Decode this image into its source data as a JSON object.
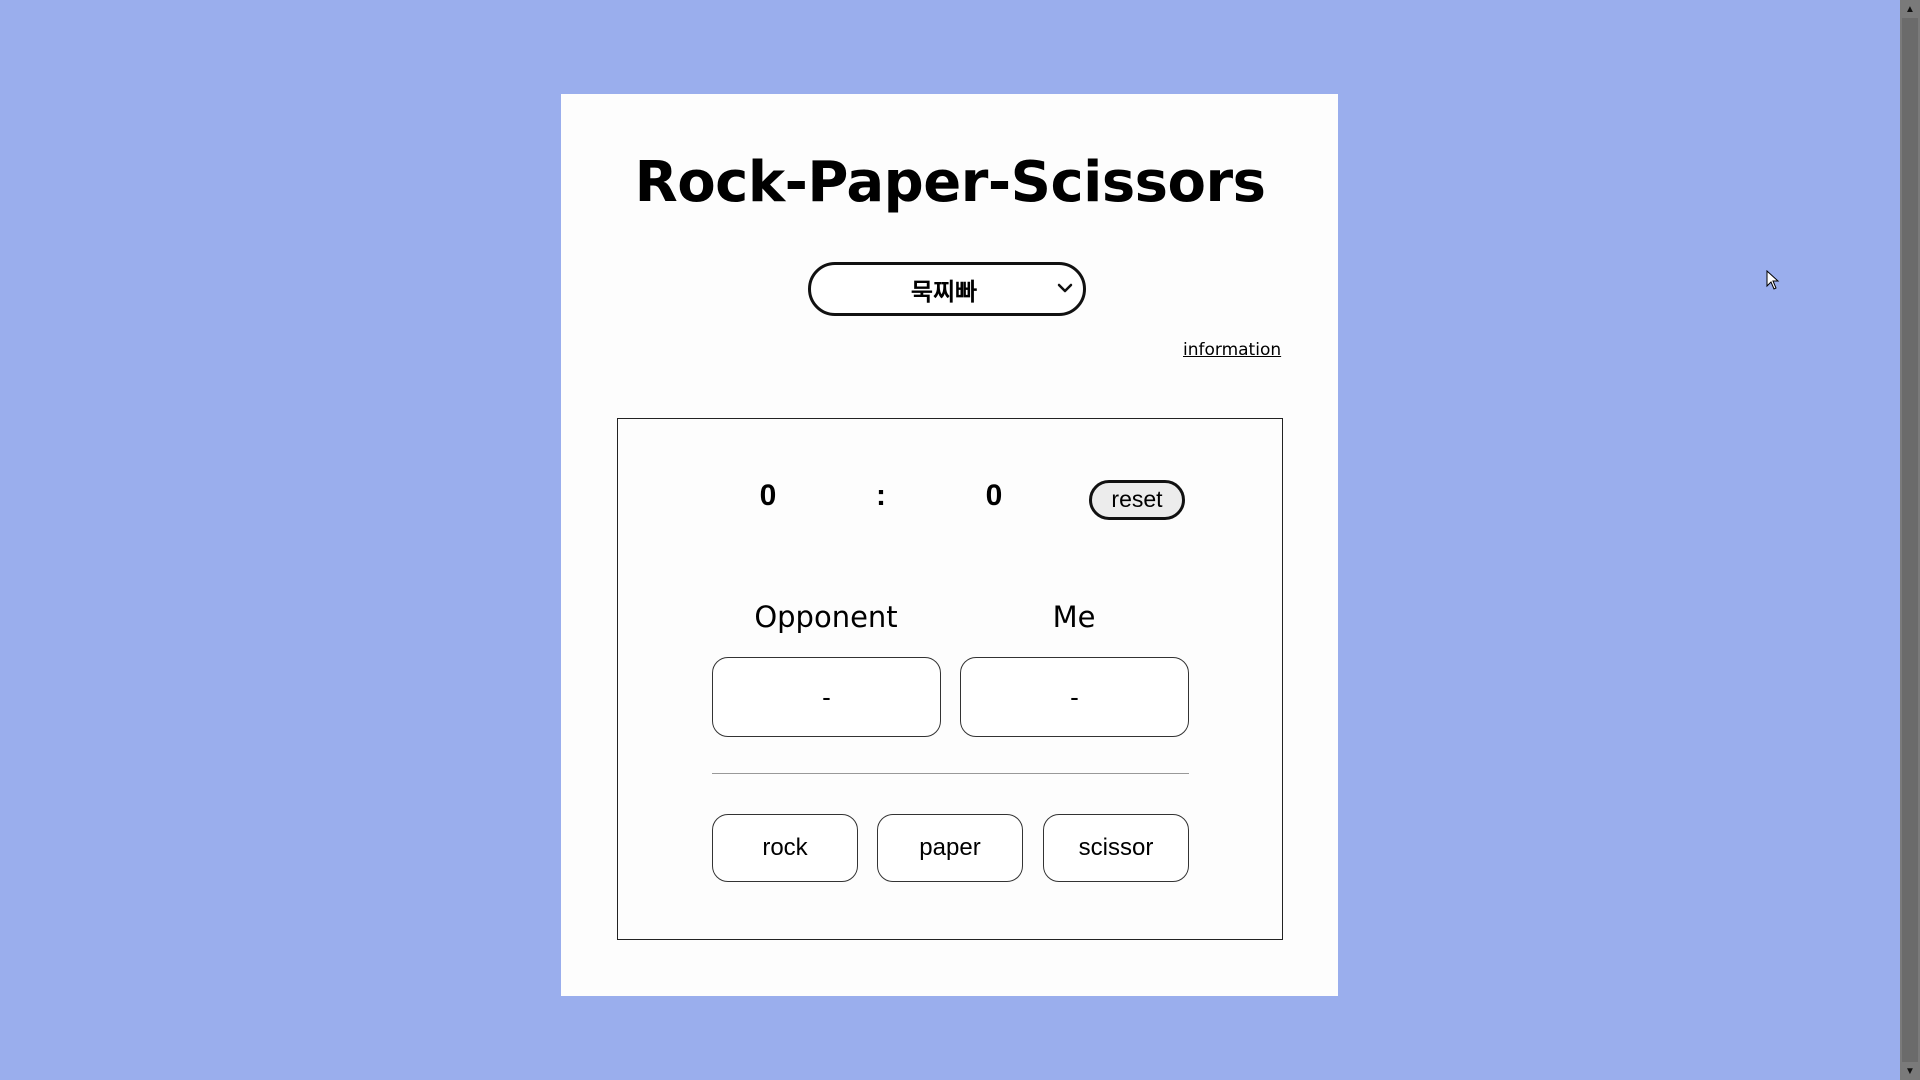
{
  "app": {
    "title": "Rock-Paper-Scissors",
    "background_color": "#9aaeed"
  },
  "mode_select": {
    "selected": "묵찌빠",
    "icon": "chevron-down-icon"
  },
  "info_link": {
    "label": "information"
  },
  "scoreboard": {
    "opponent_score": "0",
    "separator": ":",
    "my_score": "0",
    "reset_label": "reset"
  },
  "players": {
    "opponent_label": "Opponent",
    "me_label": "Me",
    "opponent_hand": "-",
    "my_hand": "-"
  },
  "choices": [
    {
      "label": "rock"
    },
    {
      "label": "paper"
    },
    {
      "label": "scissor"
    }
  ]
}
